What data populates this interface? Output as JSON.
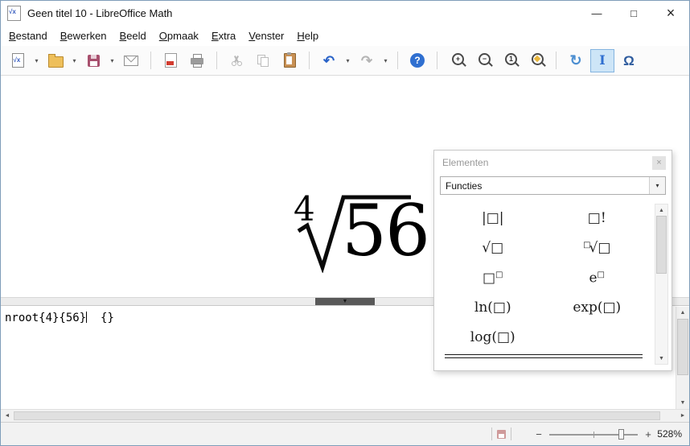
{
  "colors": {
    "accent_blue": "#2f6fd0",
    "active_button_bg": "#cde5f7",
    "active_button_border": "#84b4e0",
    "disabled_gray": "#b8b8b8"
  },
  "titlebar": {
    "icon_glyph": "√x",
    "title": "Geen titel 10 - LibreOffice Math",
    "minimize": "—",
    "maximize": "□",
    "close": "×"
  },
  "menubar": {
    "items": [
      "Bestand",
      "Bewerken",
      "Beeld",
      "Opmaak",
      "Extra",
      "Venster",
      "Help"
    ]
  },
  "toolbar": {
    "new_glyph": "√x",
    "dropdown_arrow": "▾",
    "undo_glyph": "↶",
    "redo_glyph": "↷",
    "help_glyph": "?",
    "zoom_in_sign": "+",
    "zoom_out_sign": "−",
    "zoom_100_sign": "1",
    "refresh_glyph": "↻",
    "cursor_glyph": "I",
    "symbols_glyph": "Ω"
  },
  "formula": {
    "index": "4",
    "radicand": "56"
  },
  "command": {
    "text": "nroot{4}{56}",
    "suffix": "  {}"
  },
  "elements_panel": {
    "title": "Elementen",
    "close": "×",
    "category": "Functies",
    "buttons": {
      "abs": {
        "label": "|□|"
      },
      "factorial": {
        "label": "□!"
      },
      "sqrt": {
        "label": "√□"
      },
      "nthroot": {
        "sup": "□",
        "label": "√□"
      },
      "power": {
        "label": "□",
        "sup": "□"
      },
      "e_power": {
        "label": "e",
        "sup": "□"
      },
      "ln": {
        "label": "ln(□)"
      },
      "exp": {
        "label": "exp(□)"
      },
      "log": {
        "label": "log(□)"
      }
    }
  },
  "scrollbars": {
    "up": "▲",
    "down": "▼",
    "left": "◄",
    "right": "►"
  },
  "splitter": {
    "arrow": "▼"
  },
  "statusbar": {
    "zoom_out": "−",
    "zoom_in": "+",
    "zoom_value": "528%"
  }
}
